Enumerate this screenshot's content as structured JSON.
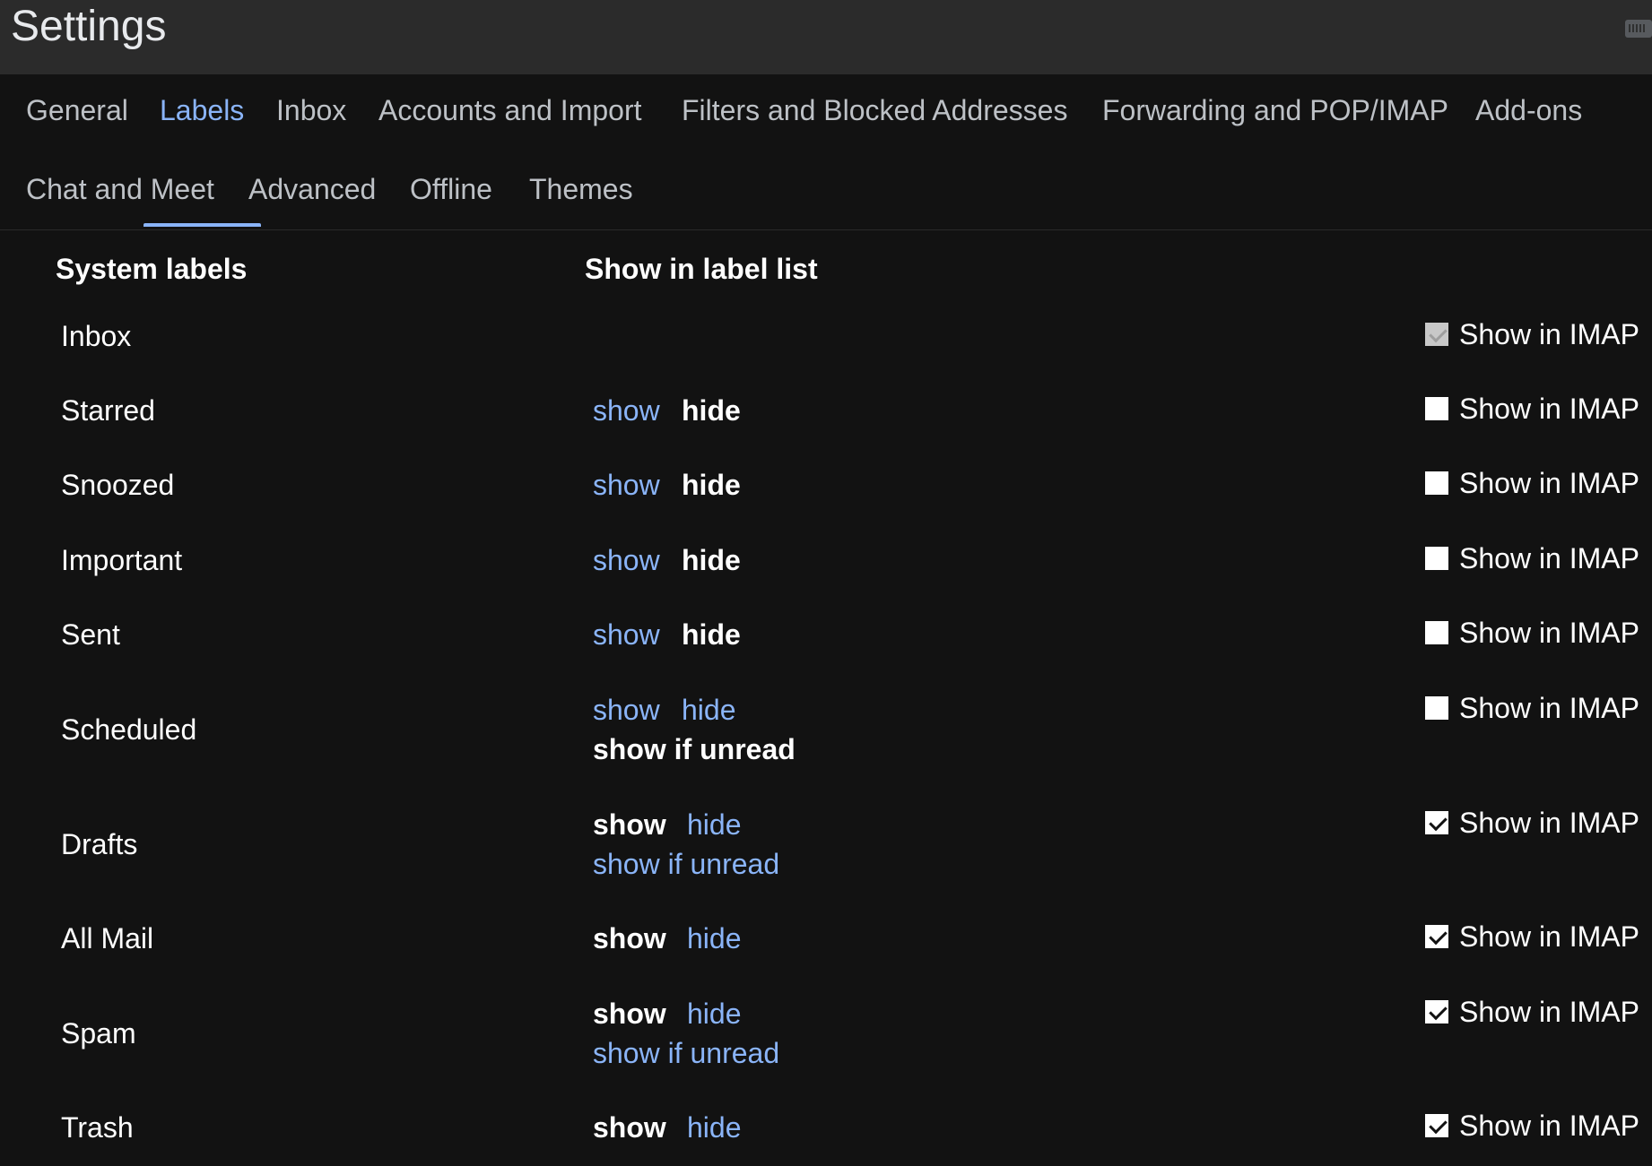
{
  "header": {
    "title": "Settings"
  },
  "tabs": [
    {
      "label": "General"
    },
    {
      "label": "Labels"
    },
    {
      "label": "Inbox"
    },
    {
      "label": "Accounts and Import"
    },
    {
      "label": "Filters and Blocked Addresses"
    },
    {
      "label": "Forwarding and POP/IMAP"
    },
    {
      "label": "Add-ons"
    },
    {
      "label": "Chat and Meet"
    },
    {
      "label": "Advanced"
    },
    {
      "label": "Offline"
    },
    {
      "label": "Themes"
    }
  ],
  "active_tab": "Labels",
  "columns": {
    "system_labels": "System labels",
    "show_in_label_list": "Show in label list"
  },
  "imap_label": "Show in IMAP",
  "options": {
    "show": "show",
    "hide": "hide",
    "show_if_unread": "show if unread"
  },
  "colors": {
    "accent": "#8ab4f8",
    "background": "#121212",
    "header_bg": "#2b2b2b"
  },
  "rows": [
    {
      "name": "Inbox",
      "selected": null,
      "imap": true,
      "imap_disabled": true
    },
    {
      "name": "Starred",
      "selected": "hide",
      "imap": false
    },
    {
      "name": "Snoozed",
      "selected": "hide",
      "imap": false
    },
    {
      "name": "Important",
      "selected": "hide",
      "imap": false
    },
    {
      "name": "Sent",
      "selected": "hide",
      "imap": false
    },
    {
      "name": "Scheduled",
      "selected": "show if unread",
      "imap": false
    },
    {
      "name": "Drafts",
      "selected": "show",
      "imap": true
    },
    {
      "name": "All Mail",
      "selected": "show",
      "imap": true
    },
    {
      "name": "Spam",
      "selected": "show",
      "imap": true
    },
    {
      "name": "Trash",
      "selected": "show",
      "imap": true
    }
  ]
}
